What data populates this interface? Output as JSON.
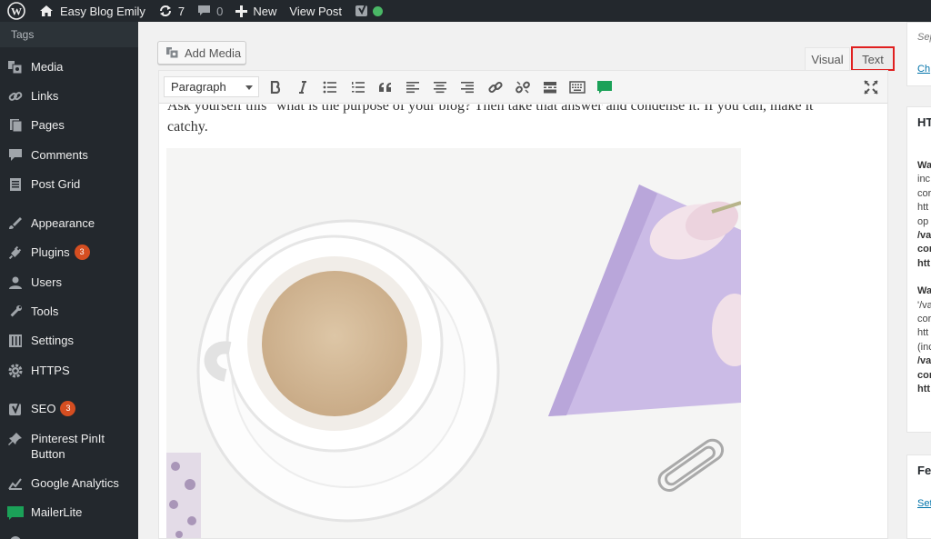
{
  "adminbar": {
    "site_name": "Easy Blog Emily",
    "updates_count": "7",
    "comments_count": "0",
    "new_label": "New",
    "view_post_label": "View Post"
  },
  "sidebar": {
    "tags_label": "Tags",
    "items": [
      {
        "label": "Media",
        "icon": "media-icon"
      },
      {
        "label": "Links",
        "icon": "links-icon"
      },
      {
        "label": "Pages",
        "icon": "pages-icon"
      },
      {
        "label": "Comments",
        "icon": "comments-icon"
      },
      {
        "label": "Post Grid",
        "icon": "post-grid-icon"
      },
      {
        "label": "Appearance",
        "icon": "appearance-icon"
      },
      {
        "label": "Plugins",
        "icon": "plugins-icon",
        "badge": "3"
      },
      {
        "label": "Users",
        "icon": "users-icon"
      },
      {
        "label": "Tools",
        "icon": "tools-icon"
      },
      {
        "label": "Settings",
        "icon": "settings-icon"
      },
      {
        "label": "HTTPS",
        "icon": "https-icon"
      },
      {
        "label": "SEO",
        "icon": "seo-icon",
        "badge": "3"
      },
      {
        "label": "Pinterest PinIt Button",
        "line1": "Pinterest PinIt",
        "line2": "Button",
        "icon": "pin-icon"
      },
      {
        "label": "Google Analytics",
        "icon": "analytics-icon"
      },
      {
        "label": "MailerLite",
        "icon": "mailerlite-icon"
      }
    ]
  },
  "editor": {
    "add_media_label": "Add Media",
    "tab_visual": "Visual",
    "tab_text": "Text",
    "format_select": "Paragraph",
    "content_line1": "Ask yourself this \"what is the purpose of your blog? Then take that answer and condense it. If you can, make it",
    "content_line2": "catchy."
  },
  "right_column": {
    "top_italic": "Sep",
    "top_link": "Ch",
    "box2_title": "HT",
    "box2_lines": [
      {
        "t": "Wa",
        "s": "b"
      },
      {
        "t": "inc",
        "s": ""
      },
      {
        "t": "cor",
        "s": ""
      },
      {
        "t": "htt",
        "s": ""
      },
      {
        "t": "op",
        "s": ""
      },
      {
        "t": "/va",
        "s": "b"
      },
      {
        "t": "cor",
        "s": "b"
      },
      {
        "t": "htt",
        "s": "b"
      },
      {
        "t": "Wa",
        "s": "b"
      },
      {
        "t": "'/va",
        "s": ""
      },
      {
        "t": "cor",
        "s": ""
      },
      {
        "t": "htt",
        "s": ""
      },
      {
        "t": "(inc",
        "s": ""
      },
      {
        "t": "/va",
        "s": "b"
      },
      {
        "t": "cor",
        "s": "b"
      },
      {
        "t": "htt",
        "s": "b"
      }
    ],
    "box3_title": "Fea",
    "box3_link": "Set"
  },
  "colors": {
    "admin_bg": "#23282d",
    "badge": "#d54e21",
    "highlight": "#e02020",
    "status_green": "#4ab866",
    "link": "#0073aa"
  }
}
